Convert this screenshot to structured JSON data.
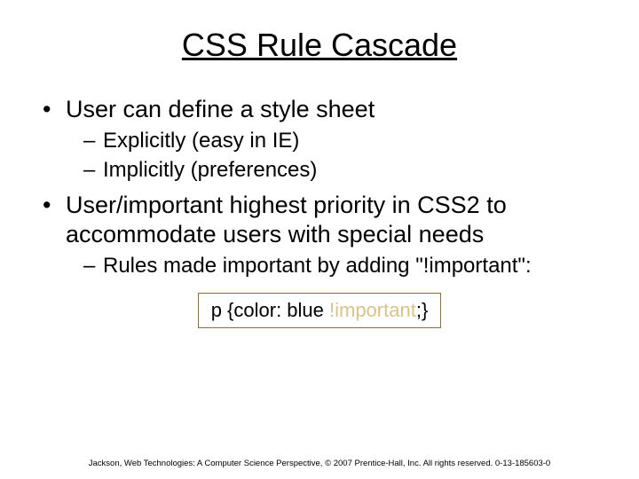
{
  "title": "CSS Rule Cascade",
  "bullets": {
    "b1": "User can define a style sheet",
    "b1_sub1": "Explicitly (easy in IE)",
    "b1_sub2": "Implicitly (preferences)",
    "b2": "User/important highest priority in CSS2 to accommodate users with special needs",
    "b2_sub1": "Rules made important by adding \"!important\":"
  },
  "code": {
    "pre": "p {color: blue ",
    "highlight": "!important",
    "post": ";}"
  },
  "footer": "Jackson, Web Technologies: A Computer Science Perspective, © 2007 Prentice-Hall, Inc. All rights reserved. 0-13-185603-0"
}
